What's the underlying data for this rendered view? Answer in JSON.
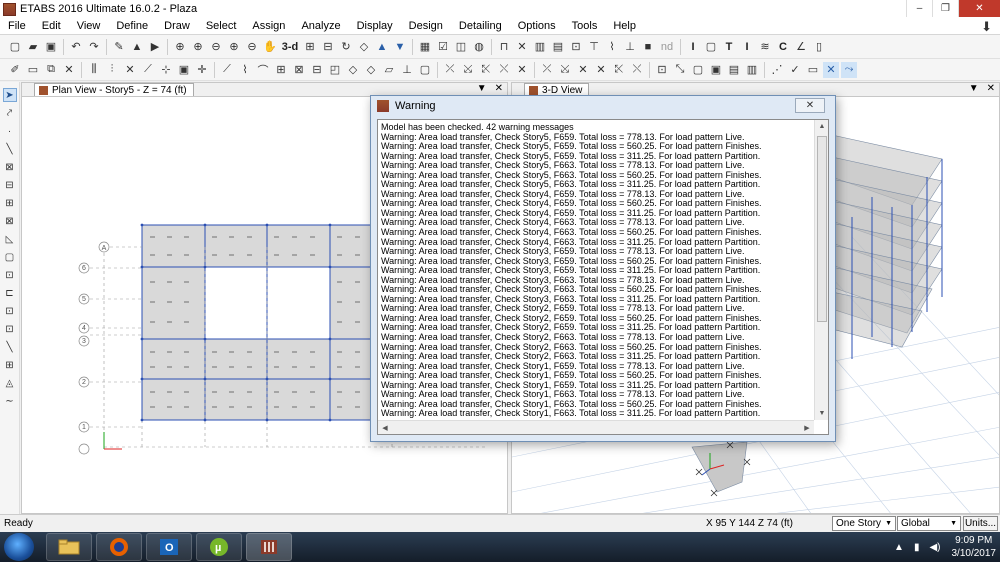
{
  "window": {
    "title": "ETABS 2016 Ultimate 16.0.2 - Plaza",
    "minimize": "–",
    "restore": "❐",
    "close": "✕"
  },
  "menu": [
    "File",
    "Edit",
    "View",
    "Define",
    "Draw",
    "Select",
    "Assign",
    "Analyze",
    "Display",
    "Design",
    "Detailing",
    "Options",
    "Tools",
    "Help"
  ],
  "toolbar": {
    "view_3d_label": "3-d",
    "nd_label": "nd"
  },
  "panes": {
    "plan": {
      "title": "Plan View - Story5 - Z = 74 (ft)"
    },
    "threed": {
      "title": "3-D View"
    },
    "close_glyph": "✕",
    "menu_glyph": "▼"
  },
  "plan_grid": {
    "column_labels": [
      "A"
    ],
    "row_labels": [
      "6",
      "5",
      "4",
      "3",
      "2",
      "1"
    ]
  },
  "dialog": {
    "title": "Warning",
    "close_label": "✕",
    "messages": [
      "Model has been checked. 42 warning messages",
      "Warning: Area load transfer, Check Story5, F659. Total loss = 778.13. For load pattern Live.",
      "Warning: Area load transfer, Check Story5, F659. Total loss = 560.25. For load pattern Finishes.",
      "Warning: Area load transfer, Check Story5, F659. Total loss = 311.25. For load pattern Partition.",
      "Warning: Area load transfer, Check Story5, F663. Total loss = 778.13. For load pattern Live.",
      "Warning: Area load transfer, Check Story5, F663. Total loss = 560.25. For load pattern Finishes.",
      "Warning: Area load transfer, Check Story5, F663. Total loss = 311.25. For load pattern Partition.",
      "Warning: Area load transfer, Check Story4, F659. Total loss = 778.13. For load pattern Live.",
      "Warning: Area load transfer, Check Story4, F659. Total loss = 560.25. For load pattern Finishes.",
      "Warning: Area load transfer, Check Story4, F659. Total loss = 311.25. For load pattern Partition.",
      "Warning: Area load transfer, Check Story4, F663. Total loss = 778.13. For load pattern Live.",
      "Warning: Area load transfer, Check Story4, F663. Total loss = 560.25. For load pattern Finishes.",
      "Warning: Area load transfer, Check Story4, F663. Total loss = 311.25. For load pattern Partition.",
      "Warning: Area load transfer, Check Story3, F659. Total loss = 778.13. For load pattern Live.",
      "Warning: Area load transfer, Check Story3, F659. Total loss = 560.25. For load pattern Finishes.",
      "Warning: Area load transfer, Check Story3, F659. Total loss = 311.25. For load pattern Partition.",
      "Warning: Area load transfer, Check Story3, F663. Total loss = 778.13. For load pattern Live.",
      "Warning: Area load transfer, Check Story3, F663. Total loss = 560.25. For load pattern Finishes.",
      "Warning: Area load transfer, Check Story3, F663. Total loss = 311.25. For load pattern Partition.",
      "Warning: Area load transfer, Check Story2, F659. Total loss = 778.13. For load pattern Live.",
      "Warning: Area load transfer, Check Story2, F659. Total loss = 560.25. For load pattern Finishes.",
      "Warning: Area load transfer, Check Story2, F659. Total loss = 311.25. For load pattern Partition.",
      "Warning: Area load transfer, Check Story2, F663. Total loss = 778.13. For load pattern Live.",
      "Warning: Area load transfer, Check Story2, F663. Total loss = 560.25. For load pattern Finishes.",
      "Warning: Area load transfer, Check Story2, F663. Total loss = 311.25. For load pattern Partition.",
      "Warning: Area load transfer, Check Story1, F659. Total loss = 778.13. For load pattern Live.",
      "Warning: Area load transfer, Check Story1, F659. Total loss = 560.25. For load pattern Finishes.",
      "Warning: Area load transfer, Check Story1, F659. Total loss = 311.25. For load pattern Partition.",
      "Warning: Area load transfer, Check Story1, F663. Total loss = 778.13. For load pattern Live.",
      "Warning: Area load transfer, Check Story1, F663. Total loss = 560.25. For load pattern Finishes.",
      "Warning: Area load transfer, Check Story1, F663. Total loss = 311.25. For load pattern Partition."
    ]
  },
  "status": {
    "ready": "Ready",
    "coords": "X 95  Y 144  Z 74 (ft)",
    "story_mode": "One Story",
    "coord_system": "Global",
    "units_button": "Units..."
  },
  "taskbar": {
    "time": "9:09 PM",
    "date": "3/10/2017"
  },
  "colors": {
    "selected_tool_bg": "#cfe3f7",
    "slab_fill": "#d9d9d9",
    "grid_line": "#2b4fb3",
    "dialog_frame": "#dfe9f5"
  }
}
